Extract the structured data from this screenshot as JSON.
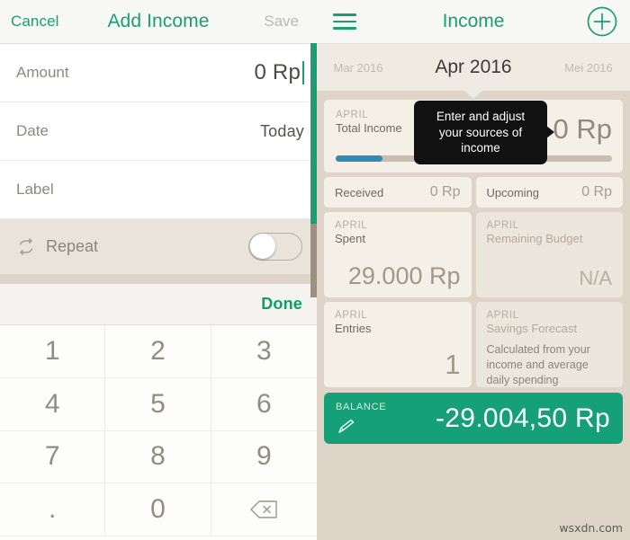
{
  "left": {
    "header": {
      "cancel_label": "Cancel",
      "title": "Add Income",
      "save_label": "Save"
    },
    "rows": [
      {
        "label": "Amount",
        "value": "0 Rp"
      },
      {
        "label": "Date",
        "value": "Today"
      },
      {
        "label": "Label",
        "value": ""
      }
    ],
    "repeat": {
      "label": "Repeat",
      "icon": "repeat-icon",
      "toggle_state": "off"
    },
    "keyboard": {
      "done_label": "Done",
      "keys": [
        "1",
        "2",
        "3",
        "4",
        "5",
        "6",
        "7",
        "8",
        "9",
        ".",
        "0",
        "backspace-icon"
      ]
    }
  },
  "right": {
    "header": {
      "menu_icon": "hamburger-menu-icon",
      "title": "Income",
      "add_icon": "plus-circle-icon"
    },
    "months": {
      "previous": "Mar 2016",
      "current": "Apr 2016",
      "next": "Mei 2016"
    },
    "total_income": {
      "month": "APRIL",
      "title": "Total Income",
      "value": "0 Rp",
      "progress_percent": 17,
      "progress_color": "#2e8cb6"
    },
    "received": {
      "label": "Received",
      "value": "0 Rp"
    },
    "upcoming": {
      "label": "Upcoming",
      "value": "0 Rp"
    },
    "spent": {
      "month": "APRIL",
      "title": "Spent",
      "value": "29.000 Rp"
    },
    "remaining_budget": {
      "month": "APRIL",
      "title": "Remaining Budget",
      "value": "N/A"
    },
    "entries": {
      "month": "APRIL",
      "title": "Entries",
      "value": "1"
    },
    "savings_forecast": {
      "month": "APRIL",
      "title": "Savings Forecast",
      "description": "Calculated from your income and average daily spending"
    },
    "balance": {
      "label": "BALANCE",
      "value": "-29.004,50 Rp",
      "edit_icon": "pencil-icon",
      "color": "#15a077"
    },
    "tooltip": {
      "text": "Enter and adjust your sources of income"
    }
  },
  "watermark": "wsxdn.com",
  "colors": {
    "accent_green": "#1a9e74",
    "balance_green": "#15a077",
    "beige_bg": "#ded5c8",
    "card_bg": "#f4f0e8",
    "progress_blue": "#2e8cb6"
  }
}
